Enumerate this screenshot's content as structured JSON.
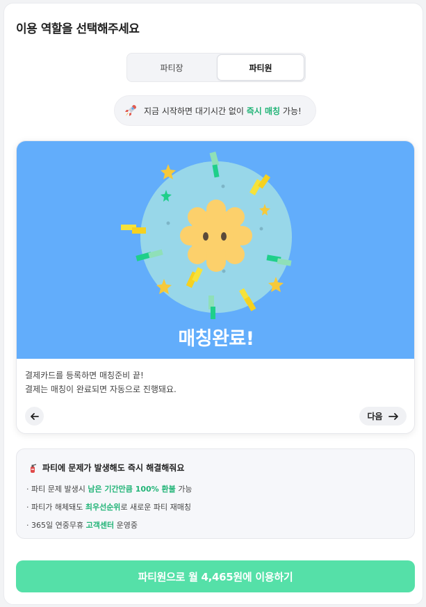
{
  "header": {
    "title": "이용 역할을 선택해주세요"
  },
  "role_tabs": [
    {
      "label": "파티장",
      "selected": false
    },
    {
      "label": "파티원",
      "selected": true
    }
  ],
  "notice": {
    "icon": "rocket-icon",
    "text_before": "지금 시작하면 대기시간 없이 ",
    "highlight": "즉시 매칭",
    "text_after": " 가능!"
  },
  "carousel": {
    "slide_title": "매칭완료!",
    "description_line1": "결제카드를 등록하면 매칭준비 끝!",
    "description_line2": "결제는 매칭이 완료되면 자동으로 진행돼요.",
    "next_label": "다음"
  },
  "benefits": {
    "icon": "fire-extinguisher-icon",
    "title": "파티에 문제가 발생해도 즉시 해결해줘요",
    "items": [
      {
        "before": "· 파티 문제 발생시 ",
        "highlight": "남은 기간만큼 100% 환불",
        "after": " 가능"
      },
      {
        "before": "· 파티가 해체돼도 ",
        "highlight": "최우선순위",
        "after": "로 새로운 파티 재매칭"
      },
      {
        "before": "· 365일 연중무휴 ",
        "highlight": "고객센터",
        "after": " 운영중"
      }
    ]
  },
  "cta": {
    "label": "파티원으로 월 4,465원에 이용하기"
  },
  "colors": {
    "accent": "#55e0a8",
    "highlight_text": "#22b477",
    "hero_background": "#62adfb"
  }
}
